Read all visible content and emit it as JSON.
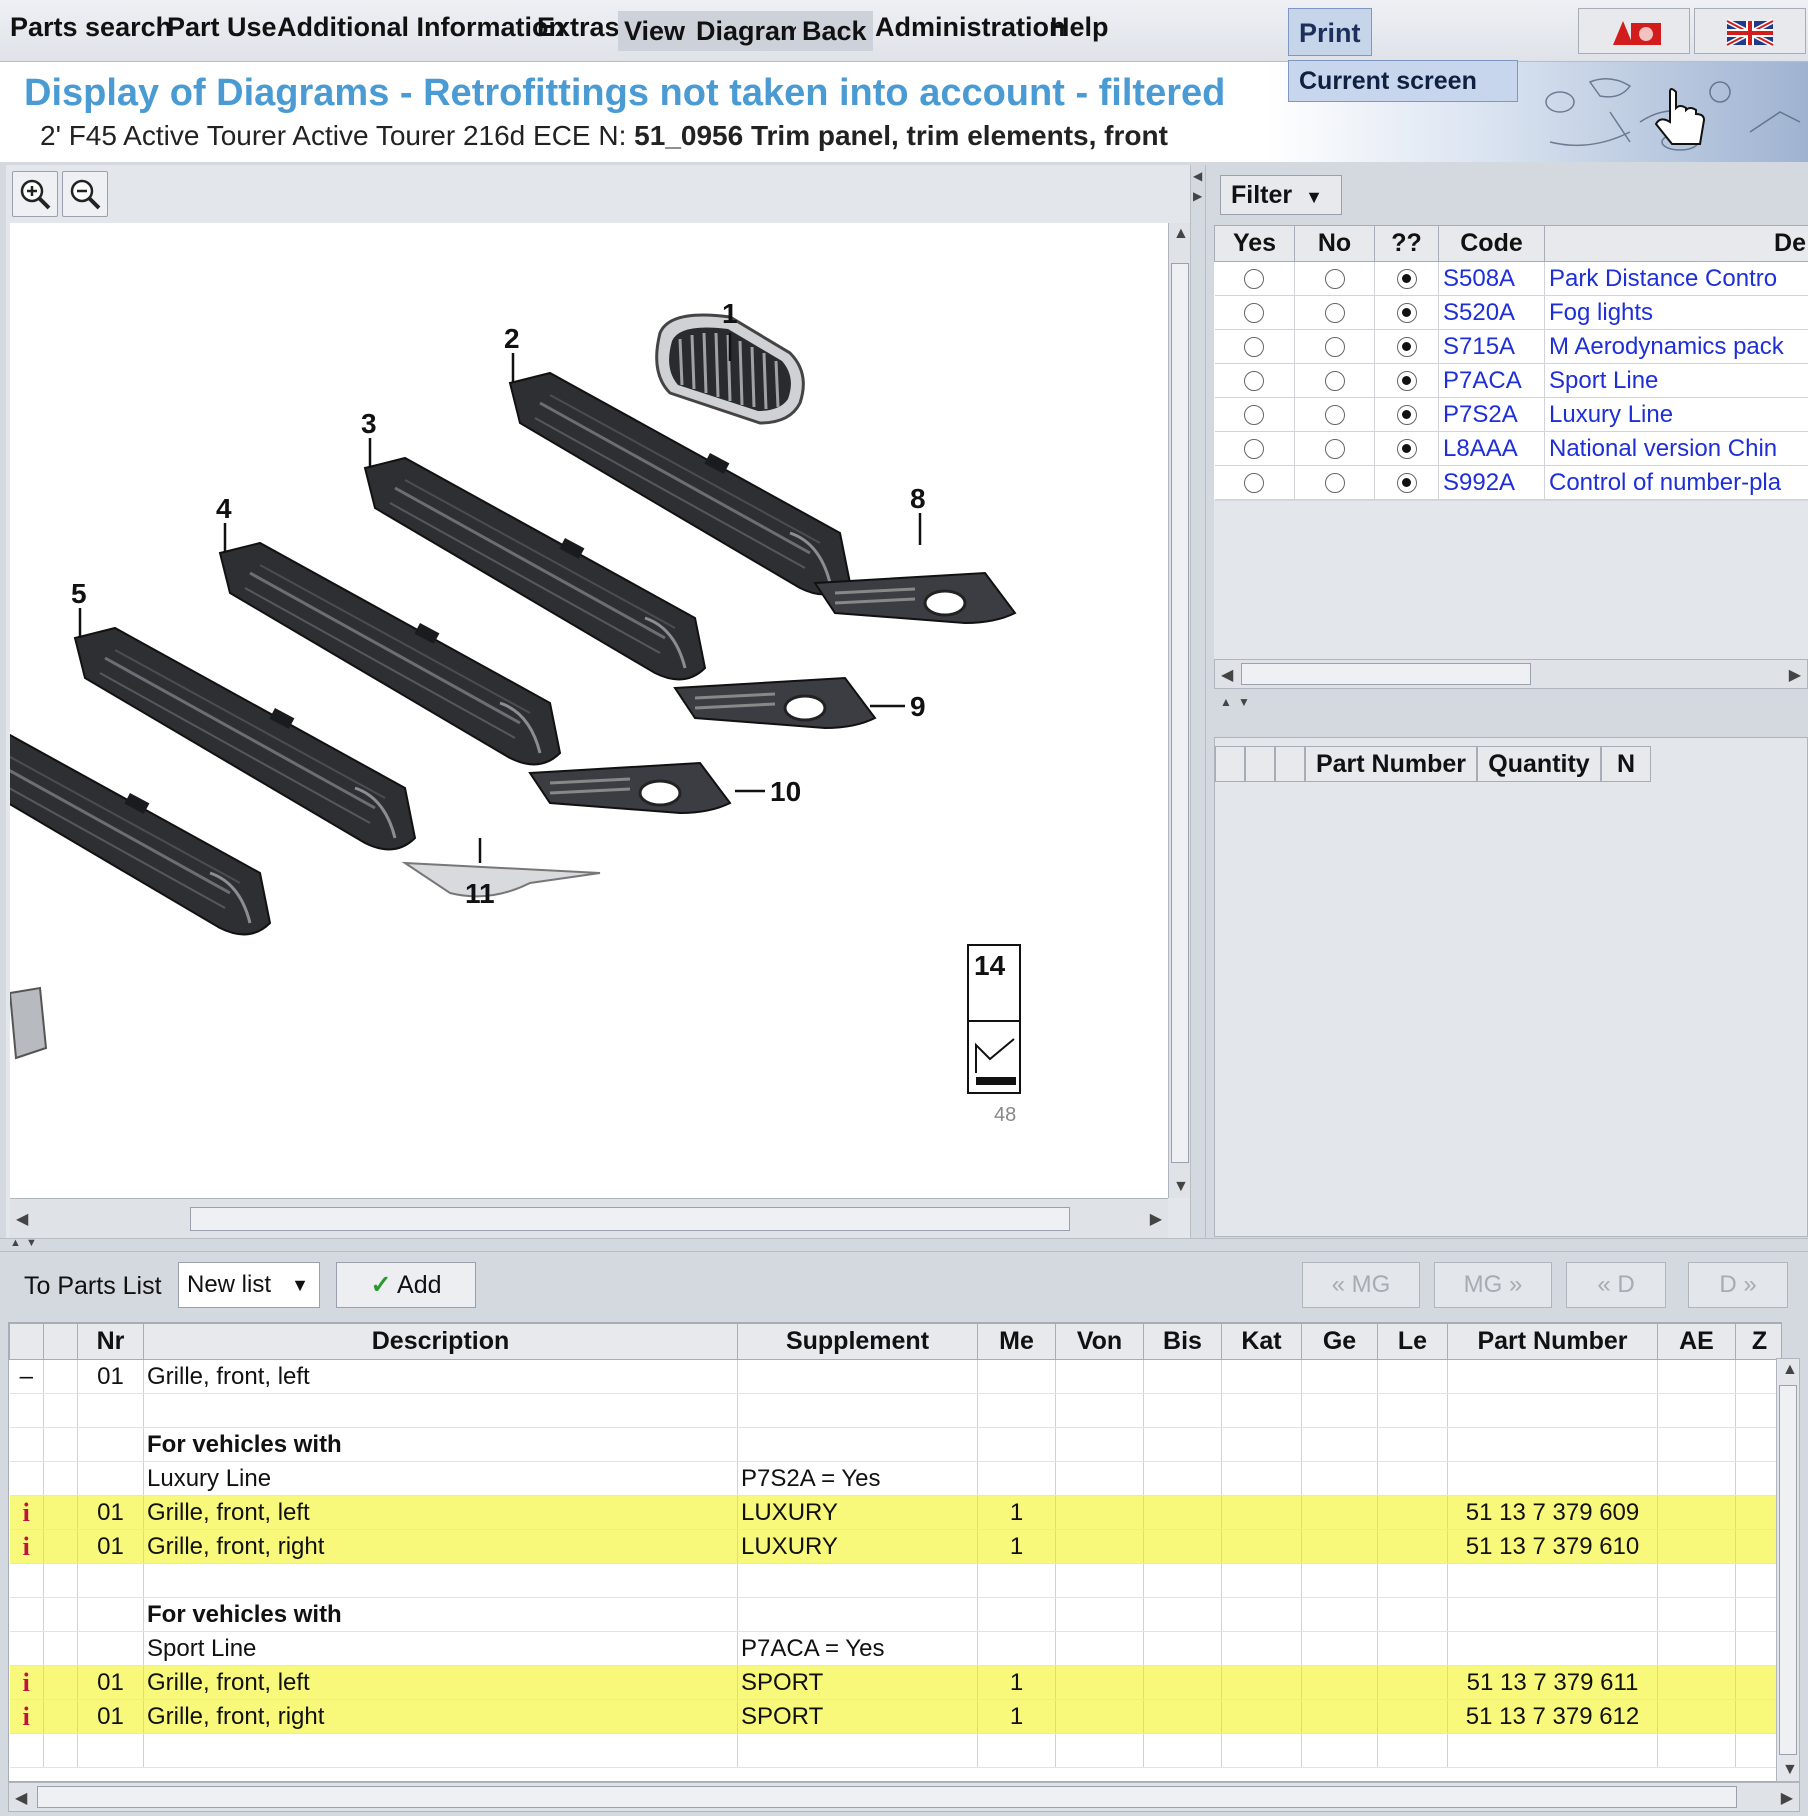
{
  "menu": {
    "items": [
      "Parts search",
      "Part Use",
      "Additional Information",
      "Extras",
      "View",
      "Diagram",
      "Back",
      "Administration",
      "Help"
    ],
    "print": "Print",
    "print_dropdown": "Current screen"
  },
  "header": {
    "title": "Display of Diagrams - Retrofittings not taken into account - filtered",
    "vehicle": "2' F45 Active Tourer Active Tourer 216d ECE  N: ",
    "diagram": "51_0956 Trim panel, trim elements, front"
  },
  "diagram": {
    "callouts": [
      "1",
      "2",
      "3",
      "4",
      "5",
      "8",
      "9",
      "10",
      "11"
    ],
    "thumbnail_label": "14",
    "scroll_marker": "48"
  },
  "filter": {
    "button": "Filter",
    "columns": [
      "Yes",
      "No",
      "??",
      "Code",
      "De"
    ],
    "rows": [
      {
        "code": "S508A",
        "desc": "Park Distance Contro"
      },
      {
        "code": "S520A",
        "desc": "Fog lights"
      },
      {
        "code": "S715A",
        "desc": "M Aerodynamics pack"
      },
      {
        "code": "P7ACA",
        "desc": "Sport Line"
      },
      {
        "code": "P7S2A",
        "desc": "Luxury Line"
      },
      {
        "code": "L8AAA",
        "desc": "National version Chin"
      },
      {
        "code": "S992A",
        "desc": "Control of number-pla"
      }
    ],
    "selected": "??"
  },
  "part_panel": {
    "columns": [
      "Part Number",
      "Quantity",
      "N"
    ]
  },
  "parts_toolbar": {
    "to_parts_list": "To Parts List",
    "select_value": "New list",
    "add": "Add",
    "prev_mg": "« MG",
    "next_mg": "MG »",
    "prev_d": "« D",
    "next_d": "D »"
  },
  "parts_table": {
    "columns": [
      "Nr",
      "Description",
      "Supplement",
      "Me",
      "Von",
      "Bis",
      "Kat",
      "Ge",
      "Le",
      "Part Number",
      "AE",
      "Z"
    ],
    "rows": [
      {
        "mark": "–",
        "nr": "01",
        "desc": "Grille, front, left",
        "supp": "",
        "me": "",
        "pn": ""
      },
      {
        "mark": "",
        "nr": "",
        "desc": "",
        "supp": "",
        "me": "",
        "pn": ""
      },
      {
        "mark": "",
        "nr": "",
        "desc": "For vehicles with",
        "supp": "",
        "me": "",
        "pn": ""
      },
      {
        "mark": "",
        "nr": "",
        "desc": "Luxury Line",
        "supp": "P7S2A = Yes",
        "me": "",
        "pn": ""
      },
      {
        "mark": "i",
        "nr": "01",
        "desc": "Grille, front, left",
        "supp": "LUXURY",
        "me": "1",
        "pn": "51 13 7 379 609"
      },
      {
        "mark": "i",
        "nr": "01",
        "desc": "Grille, front, right",
        "supp": "LUXURY",
        "me": "1",
        "pn": "51 13 7 379 610"
      },
      {
        "mark": "",
        "nr": "",
        "desc": "",
        "supp": "",
        "me": "",
        "pn": ""
      },
      {
        "mark": "",
        "nr": "",
        "desc": "For vehicles with",
        "supp": "",
        "me": "",
        "pn": ""
      },
      {
        "mark": "",
        "nr": "",
        "desc": "Sport Line",
        "supp": "P7ACA = Yes",
        "me": "",
        "pn": ""
      },
      {
        "mark": "i",
        "nr": "01",
        "desc": "Grille, front, left",
        "supp": "SPORT",
        "me": "1",
        "pn": "51 13 7 379 611"
      },
      {
        "mark": "i",
        "nr": "01",
        "desc": "Grille, front, right",
        "supp": "SPORT",
        "me": "1",
        "pn": "51 13 7 379 612"
      },
      {
        "mark": "",
        "nr": "",
        "desc": "",
        "supp": "",
        "me": "",
        "pn": ""
      }
    ],
    "highlight_color": "#f8f87a"
  },
  "colors": {
    "title": "#4a9ad3",
    "code_link": "#1f2fd8",
    "info_icon": "#c0123a"
  }
}
